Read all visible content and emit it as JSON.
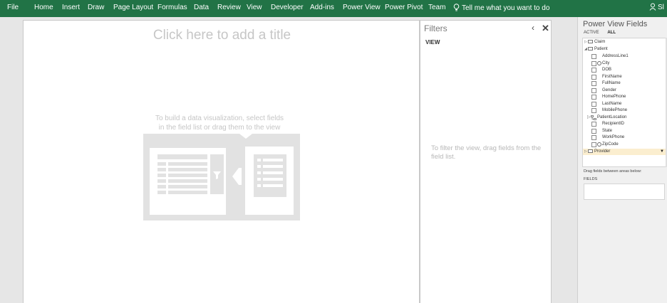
{
  "ribbon": {
    "tabs": [
      "File",
      "Home",
      "Insert",
      "Draw",
      "Page Layout",
      "Formulas",
      "Data",
      "Review",
      "View",
      "Developer",
      "Add-ins",
      "Power View",
      "Power Pivot",
      "Team"
    ],
    "tell_me": "Tell me what you want to do",
    "user_initials": "Sl",
    "icons": [
      "lightbulb-icon",
      "person-icon"
    ]
  },
  "canvas": {
    "title_placeholder": "Click here to add a title",
    "hint_line1": "To build a data visualization, select fields",
    "hint_line2": "in the field list or drag them to the view"
  },
  "filters": {
    "title": "Filters",
    "collapse_glyph": "‹",
    "close_glyph": "✕",
    "view_label": "VIEW",
    "empty_message": "To filter the view, drag fields from the field list."
  },
  "power_view_fields": {
    "title": "Power View Fields",
    "tab_active": "ACTIVE",
    "tab_all": "ALL",
    "tables": {
      "claim": "Claim",
      "patient": "Patient",
      "provider": "Provider"
    },
    "patient_fields": [
      "AddressLine1",
      "City",
      "DOB",
      "FirstName",
      "FullName",
      "Gender",
      "HomePhone",
      "LastName",
      "MobilePhone",
      "PatientLocation",
      "RecipientID",
      "State",
      "WorkPhone",
      "ZipCode"
    ],
    "drag_hint": "Drag fields between areas below:",
    "fields_area_label": "FIELDS"
  },
  "colors": {
    "ribbon": "#217346",
    "placeholder_text": "#c6c6c6",
    "illustration": "#e2e2e2",
    "provider_highlight": "#fbeecf"
  }
}
